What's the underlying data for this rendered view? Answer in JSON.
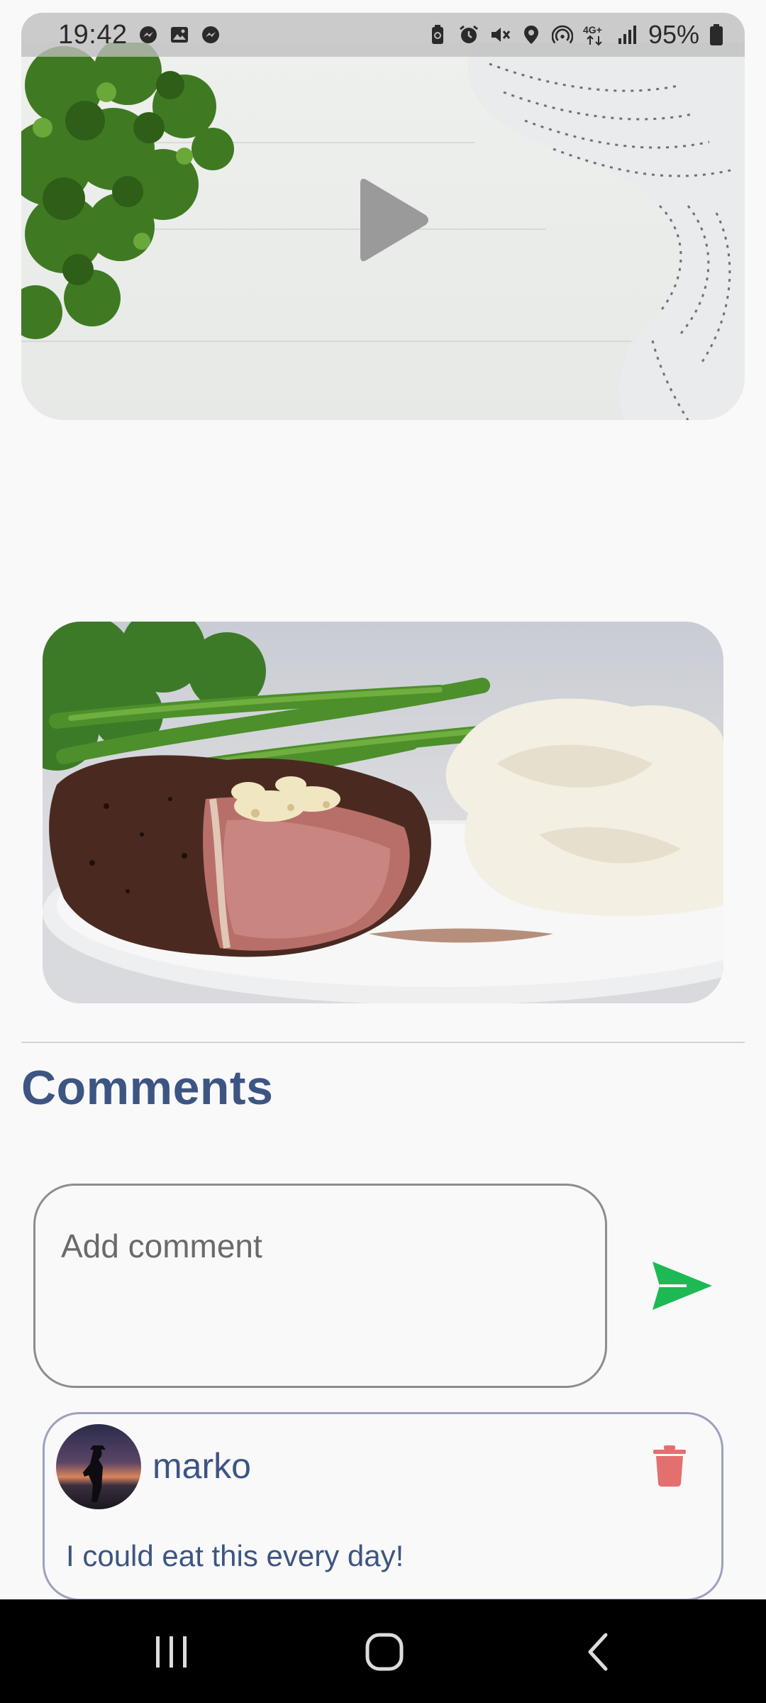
{
  "status_bar": {
    "time": "19:42",
    "battery": "95%",
    "left_icons": [
      "messenger-icon",
      "gallery-icon",
      "messenger-icon"
    ],
    "right_icons": [
      "battery-saver-icon",
      "alarm-icon",
      "mute-icon",
      "location-icon",
      "hotspot-icon",
      "4g-icon",
      "signal-icon",
      "battery-icon"
    ],
    "network_label": "4G+"
  },
  "video": {
    "play_icon": "play-icon"
  },
  "comments": {
    "title": "Comments",
    "input_placeholder": "Add comment",
    "input_value": "",
    "send_icon": "send-icon",
    "items": [
      {
        "username": "marko",
        "text": "I could eat this every day!",
        "delete_icon": "trash-icon"
      }
    ]
  },
  "colors": {
    "accent_blue": "#3d5582",
    "send_green": "#1db954",
    "delete_red": "#e46f6f",
    "background": "#f9f9f9"
  },
  "nav_bar": {
    "icons": [
      "recents-icon",
      "home-icon",
      "back-icon"
    ]
  }
}
